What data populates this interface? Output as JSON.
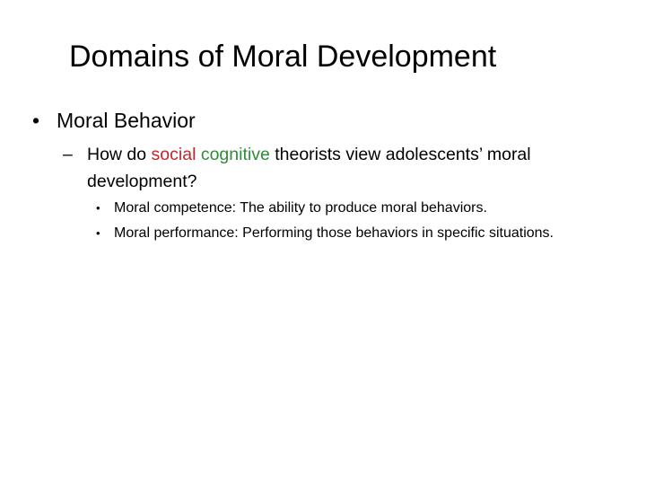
{
  "slide": {
    "title": "Domains of Moral Development",
    "bullet_glyph": "•",
    "dash_glyph": "–",
    "level1": {
      "text": "Moral Behavior"
    },
    "level2": {
      "prefix": "How do ",
      "word_social": "social",
      "space": " ",
      "word_cognitive": "cognitive",
      "suffix": " theorists view adolescents’ moral development?"
    },
    "level3": [
      {
        "text": "Moral competence: The ability to produce moral behaviors."
      },
      {
        "text": "Moral performance: Performing those behaviors in specific situations."
      }
    ]
  },
  "colors": {
    "social": "#c0262d",
    "cognitive": "#2f8a3a"
  }
}
